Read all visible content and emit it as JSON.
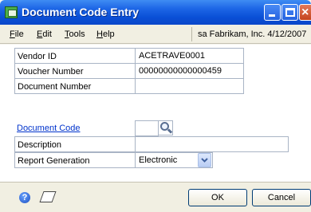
{
  "window": {
    "title": "Document Code Entry",
    "controls": {
      "minimize": "minimize",
      "maximize": "maximize",
      "close": "×"
    }
  },
  "menu": {
    "items": [
      {
        "label": "File",
        "key": "F",
        "rest": "ile"
      },
      {
        "label": "Edit",
        "key": "E",
        "rest": "dit"
      },
      {
        "label": "Tools",
        "key": "T",
        "rest": "ools"
      },
      {
        "label": "Help",
        "key": "H",
        "rest": "elp"
      }
    ],
    "company_info": "sa  Fabrikam, Inc.  4/12/2007"
  },
  "form": {
    "vendor_id": {
      "label": "Vendor ID",
      "value": "ACETRAVE0001"
    },
    "voucher_number": {
      "label": "Voucher Number",
      "value": "00000000000000459"
    },
    "document_number": {
      "label": "Document Number",
      "value": ""
    },
    "document_code": {
      "label": "Document Code",
      "value": ""
    },
    "description": {
      "label": "Description",
      "value": ""
    },
    "report_generation": {
      "label": "Report Generation",
      "value": "Electronic"
    }
  },
  "icons": {
    "lookup": "magnifier-icon",
    "dropdown": "chevron-down-icon",
    "help": "help-icon",
    "note": "note-icon"
  },
  "buttons": {
    "ok": "OK",
    "cancel": "Cancel"
  }
}
